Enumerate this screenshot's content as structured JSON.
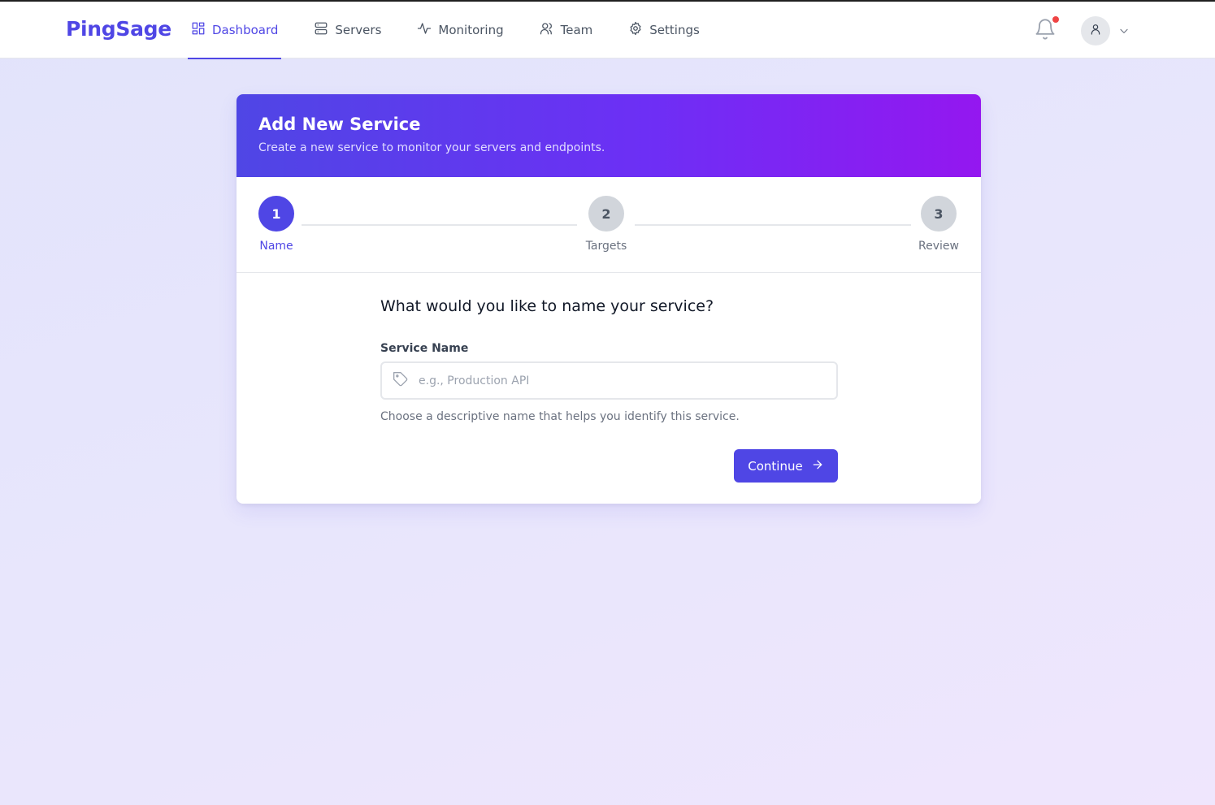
{
  "app": {
    "name": "PingSage"
  },
  "nav": {
    "items": [
      {
        "label": "Dashboard",
        "icon": "grid-icon",
        "active": true
      },
      {
        "label": "Servers",
        "icon": "server-icon",
        "active": false
      },
      {
        "label": "Monitoring",
        "icon": "activity-icon",
        "active": false
      },
      {
        "label": "Team",
        "icon": "users-icon",
        "active": false
      },
      {
        "label": "Settings",
        "icon": "gear-icon",
        "active": false
      }
    ]
  },
  "header": {
    "has_notification": true,
    "notification_dot_color": "#ef4444"
  },
  "card": {
    "title": "Add New Service",
    "subtitle": "Create a new service to monitor your servers and endpoints."
  },
  "stepper": {
    "current_step": 1,
    "steps": [
      {
        "number": "1",
        "label": "Name"
      },
      {
        "number": "2",
        "label": "Targets"
      },
      {
        "number": "3",
        "label": "Review"
      }
    ]
  },
  "form": {
    "question": "What would you like to name your service?",
    "field_label": "Service Name",
    "input_value": "",
    "input_placeholder": "e.g., Production API",
    "helper_text": "Choose a descriptive name that helps you identify this service.",
    "continue_label": "Continue"
  },
  "colors": {
    "accent": "#4f46e5",
    "gradient_end": "#9417f0",
    "inactive_step": "#d1d5db"
  }
}
